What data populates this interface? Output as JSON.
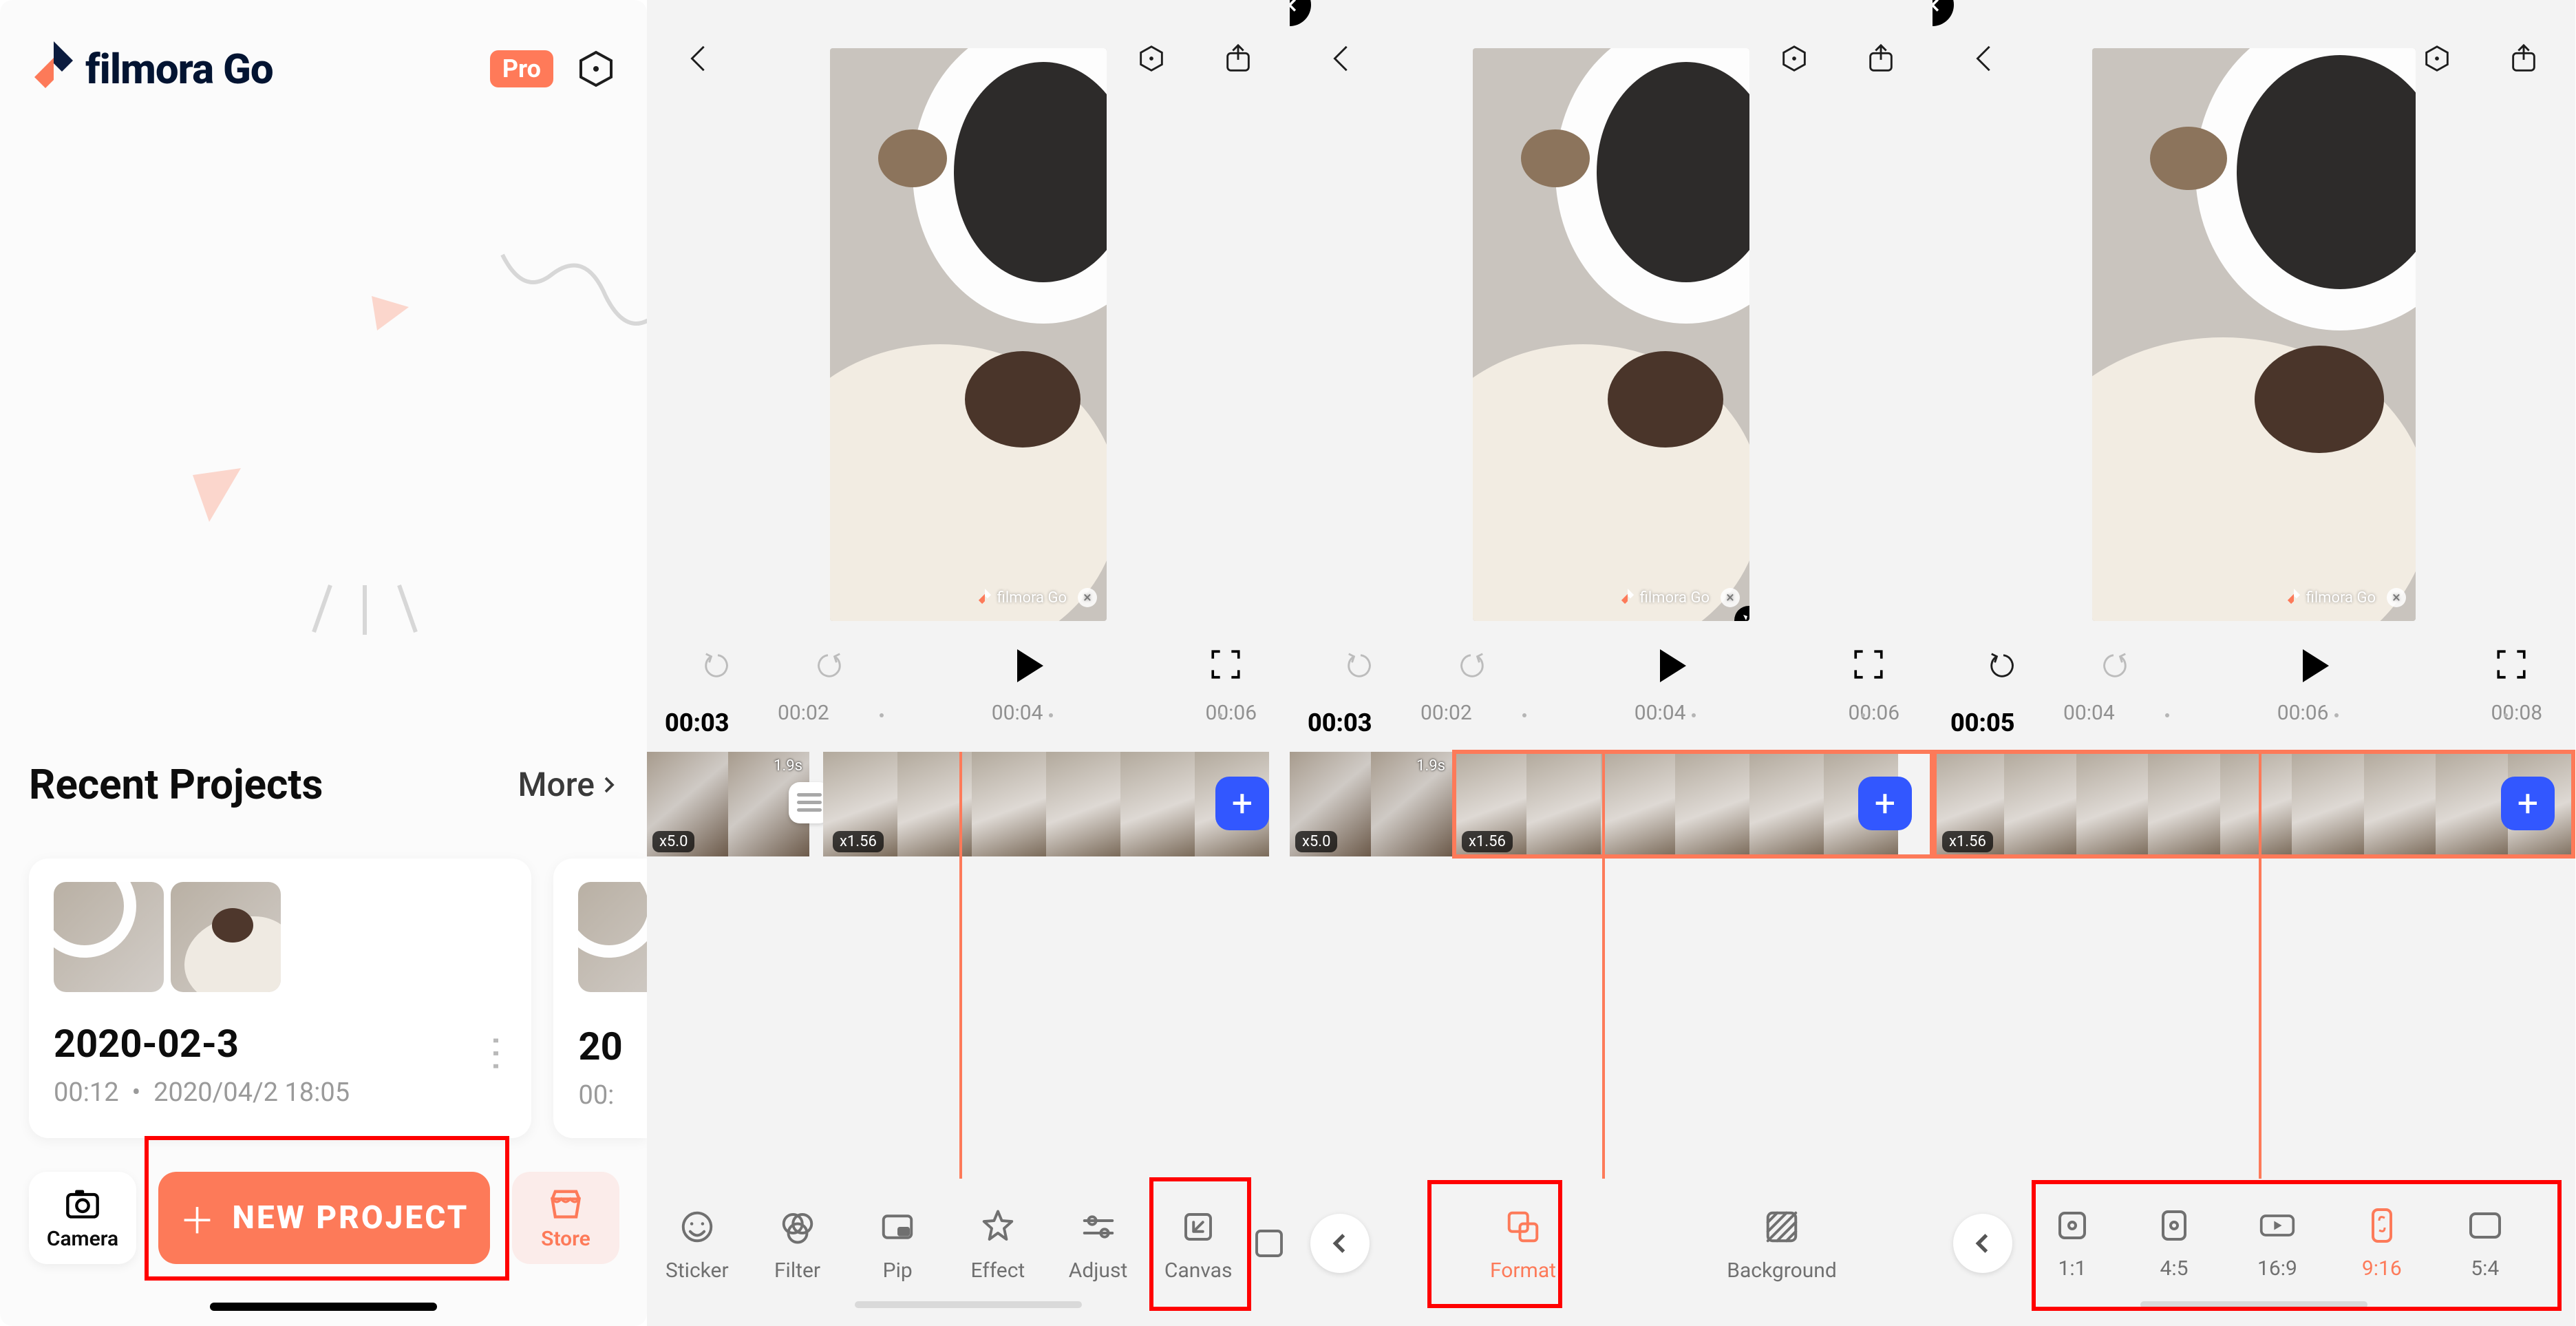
{
  "home": {
    "app_name": "filmora Go",
    "pro_badge": "Pro",
    "recent_title": "Recent Projects",
    "more_label": "More",
    "projects": [
      {
        "title": "2020-02-3",
        "duration": "00:12",
        "date": "2020/04/2 18:05"
      },
      {
        "title_peek": "20",
        "duration_peek": "00:"
      }
    ],
    "camera_label": "Camera",
    "store_label": "Store",
    "new_project_label": "NEW PROJECT"
  },
  "editor_common": {
    "watermark_text": "filmora Go",
    "clipA_speed": "x5.0",
    "clipA_dur": "1.9s",
    "clipB_speed": "x1.56",
    "add_label": "+"
  },
  "pane2": {
    "current_time": "00:03",
    "ruler": [
      "00:02",
      "00:04",
      "00:06"
    ],
    "tools": [
      "Sticker",
      "Filter",
      "Pip",
      "Effect",
      "Adjust",
      "Canvas"
    ]
  },
  "pane3": {
    "current_time": "00:03",
    "ruler": [
      "00:02",
      "00:04",
      "00:06"
    ],
    "tools": [
      "Format",
      "Background"
    ]
  },
  "pane4": {
    "current_time": "00:05",
    "ruler": [
      "00:04",
      "00:06",
      "00:08"
    ],
    "ratios": [
      "1:1",
      "4:5",
      "16:9",
      "9:16",
      "5:4"
    ],
    "active_ratio": "9:16"
  }
}
